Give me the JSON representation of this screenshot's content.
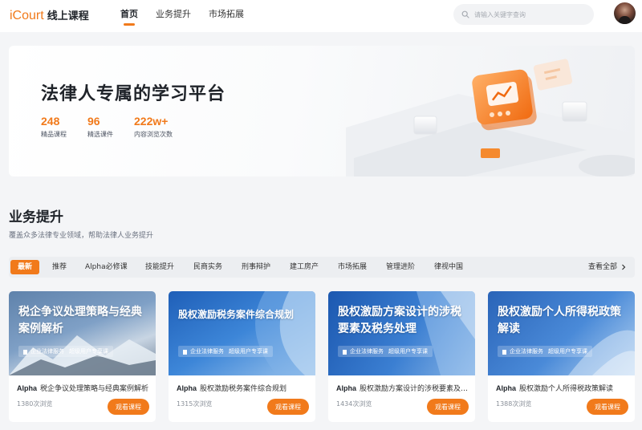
{
  "header": {
    "brand": "iCourt",
    "brand_suffix": "线上课程",
    "nav": [
      {
        "label": "首页",
        "active": true
      },
      {
        "label": "业务提升",
        "active": false
      },
      {
        "label": "市场拓展",
        "active": false
      }
    ],
    "search_placeholder": "请输入关键字查询",
    "search_icon": "search-icon",
    "avatar": "avatar"
  },
  "banner": {
    "title": "法律人专属的学习平台",
    "stats": [
      {
        "value": "248",
        "label": "精品课程"
      },
      {
        "value": "96",
        "label": "精选课件"
      },
      {
        "value": "222w+",
        "label": "内容浏览次数"
      }
    ]
  },
  "section": {
    "title": "业务提升",
    "subtitle": "覆盖众多法律专业领域，帮助法律人业务提升"
  },
  "tabs": {
    "items": [
      "最新",
      "推荐",
      "Alpha必修课",
      "技能提升",
      "民商实务",
      "刑事辩护",
      "建工房产",
      "市场拓展",
      "管理进阶",
      "律视中国"
    ],
    "active_index": 0,
    "view_all": "查看全部"
  },
  "cards": [
    {
      "cover_title": "税企争议处理策略与经典案例解析",
      "tag_a": "企业法律服务",
      "tag_b": "超级用户专享课",
      "prefix": "Alpha",
      "name": "税企争议处理策略与经典案例解析",
      "views": "1380次浏览",
      "button": "观看课程"
    },
    {
      "cover_title": "股权激励税务案件综合规划",
      "tag_a": "企业法律服务",
      "tag_b": "超级用户专享课",
      "prefix": "Alpha",
      "name": "股权激励税务案件综合规划",
      "views": "1315次浏览",
      "button": "观看课程"
    },
    {
      "cover_title": "股权激励方案设计的涉税要素及税务处理",
      "tag_a": "企业法律服务",
      "tag_b": "超级用户专享课",
      "prefix": "Alpha",
      "name": "股权激励方案设计的涉税要素及税务处理",
      "views": "1434次浏览",
      "button": "观看课程"
    },
    {
      "cover_title": "股权激励个人所得税政策解读",
      "tag_a": "企业法律服务",
      "tag_b": "超级用户专享课",
      "prefix": "Alpha",
      "name": "股权激励个人所得税政策解读",
      "views": "1388次浏览",
      "button": "观看课程"
    }
  ],
  "colors": {
    "accent": "#f17a1b",
    "text": "#1f2329",
    "background": "#f4f5f7"
  }
}
